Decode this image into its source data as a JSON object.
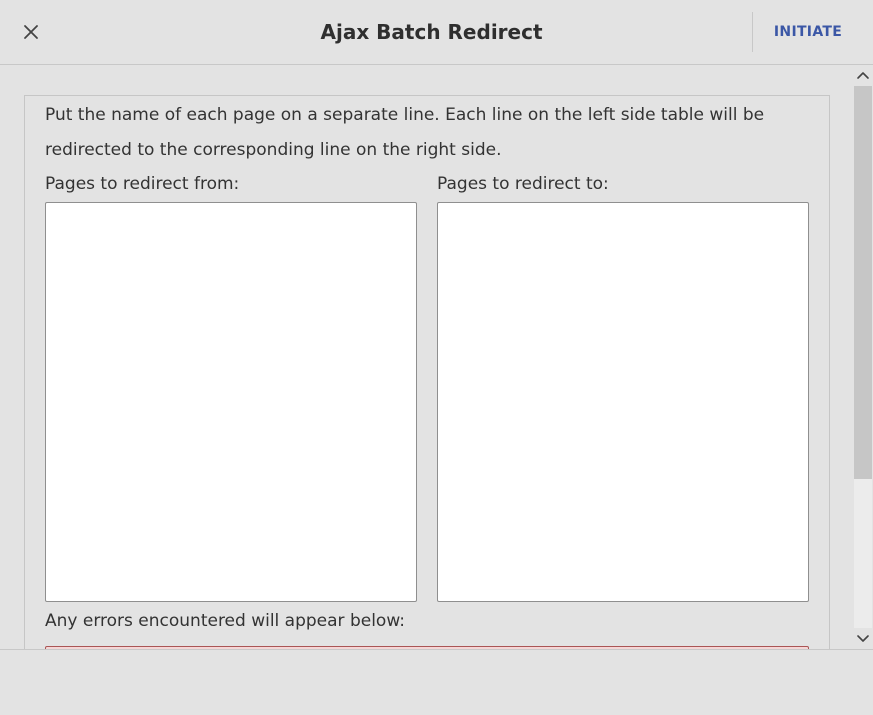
{
  "dialog": {
    "title": "Ajax Batch Redirect",
    "close_icon": "close-icon",
    "initiate_label": "INITIATE",
    "accent_color": "#3b57a6"
  },
  "form": {
    "instructions": "Put the name of each page on a separate line. Each line on the left side table will be redirected to the corresponding line on the right side.",
    "from_label": "Pages to redirect from:",
    "from_value": "",
    "to_label": "Pages to redirect to:",
    "to_value": "",
    "errors_label": "Any errors encountered will appear below:",
    "errors_value": "",
    "error_color": "#f4d6d6"
  },
  "scrollbar": {
    "up_icon": "chevron-up-icon",
    "down_icon": "chevron-down-icon"
  }
}
